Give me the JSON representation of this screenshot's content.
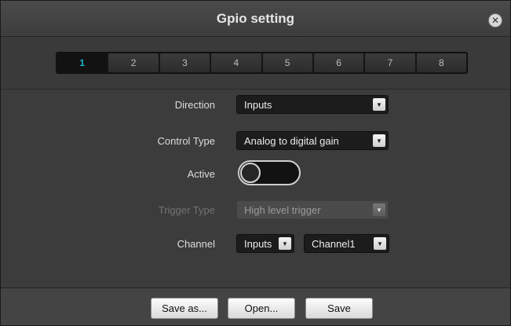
{
  "dialog": {
    "title": "Gpio setting"
  },
  "tabs": {
    "items": [
      "1",
      "2",
      "3",
      "4",
      "5",
      "6",
      "7",
      "8"
    ],
    "selected": "1",
    "accent_color": "#18b2c8"
  },
  "form": {
    "direction": {
      "label": "Direction",
      "value": "Inputs"
    },
    "control_type": {
      "label": "Control Type",
      "value": "Analog to digital gain"
    },
    "active": {
      "label": "Active",
      "state": "off"
    },
    "trigger_type": {
      "label": "Trigger Type",
      "value": "High level trigger",
      "disabled": true
    },
    "channel": {
      "label": "Channel",
      "source_value": "Inputs",
      "channel_value": "Channel1"
    }
  },
  "footer": {
    "save_as_label": "Save as...",
    "open_label": "Open...",
    "save_label": "Save"
  },
  "icons": {
    "close": "close-icon",
    "dropdown": "chevron-down-icon"
  }
}
